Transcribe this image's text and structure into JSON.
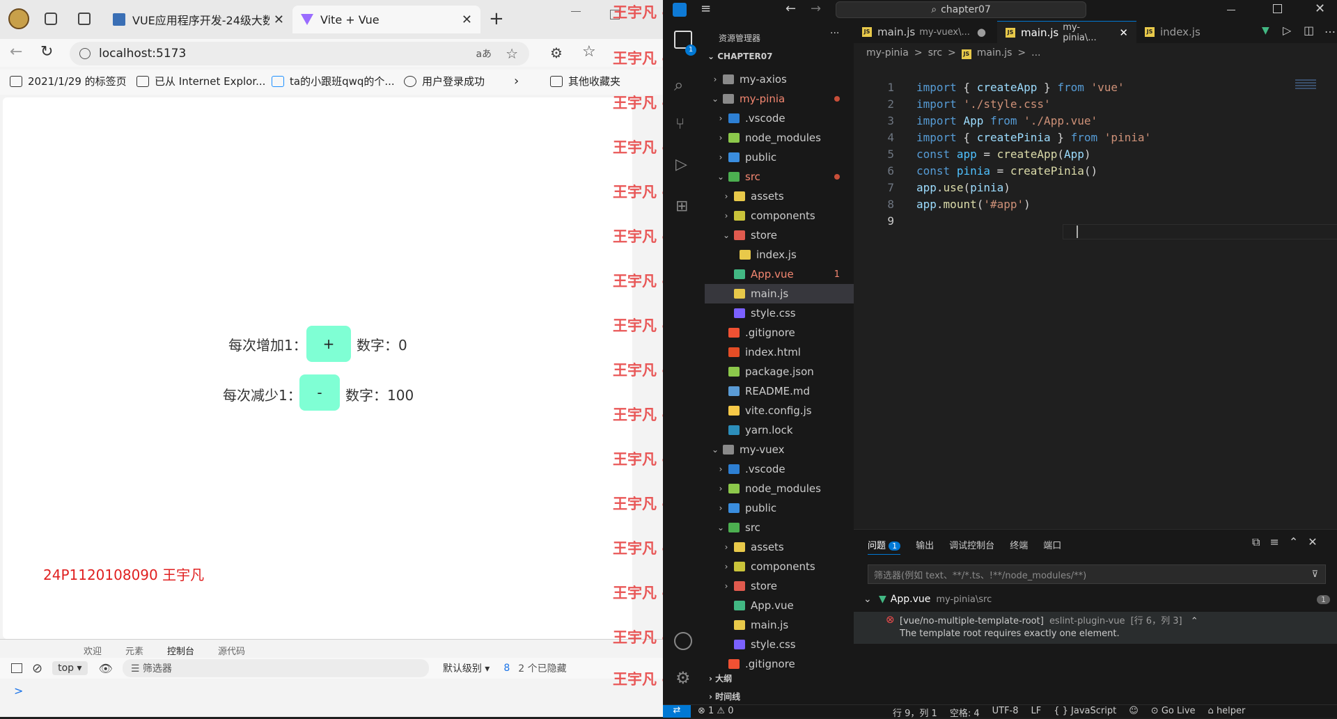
{
  "browser": {
    "tabs": [
      {
        "title": "VUE应用程序开发-24级大数据",
        "close": "✕"
      },
      {
        "title": "Vite + Vue",
        "close": "✕"
      }
    ],
    "new_tab": "+",
    "url": "localhost:5173",
    "read_aloud": "aあ",
    "favorites": [
      {
        "label": "2021/1/29 的标签页"
      },
      {
        "label": "已从 Internet Explor..."
      },
      {
        "label": "ta的小跟班qwq的个..."
      },
      {
        "label": "用户登录成功"
      }
    ],
    "favorites_more": "其他收藏夹",
    "page": {
      "row1": {
        "label": "每次增加1：",
        "button": "+",
        "value_label": "数字：0"
      },
      "row2": {
        "label": "每次减少1：",
        "button": "-",
        "value_label": "数字：100"
      },
      "student": "24P1120108090 王宇凡"
    },
    "devtools": {
      "tabs": [
        "欢迎",
        "元素",
        "控制台",
        "源代码"
      ],
      "context": "top",
      "filter_placeholder": "筛选器",
      "level": "默认级别",
      "issues_count": "8",
      "hidden": "2 个已隐藏",
      "prompt": ">"
    },
    "watermark": "王宇凡 -126 - 1452"
  },
  "vscode": {
    "search": "chapter07",
    "explorer_title": "资源管理器",
    "explorer_more": "···",
    "root": "CHAPTER07",
    "activity_badge": "1",
    "tree": [
      {
        "label": "my-axios",
        "indent": 1,
        "chev": "›",
        "kind": "folder"
      },
      {
        "label": "my-pinia",
        "indent": 1,
        "chev": "⌄",
        "kind": "folder",
        "dot": true
      },
      {
        "label": ".vscode",
        "indent": 2,
        "chev": "›",
        "kind": "vscode"
      },
      {
        "label": "node_modules",
        "indent": 2,
        "chev": "›",
        "kind": "node"
      },
      {
        "label": "public",
        "indent": 2,
        "chev": "›",
        "kind": "public"
      },
      {
        "label": "src",
        "indent": 2,
        "chev": "⌄",
        "kind": "src",
        "dot": true
      },
      {
        "label": "assets",
        "indent": 3,
        "chev": "›",
        "kind": "assets"
      },
      {
        "label": "components",
        "indent": 3,
        "chev": "›",
        "kind": "components"
      },
      {
        "label": "store",
        "indent": 3,
        "chev": "⌄",
        "kind": "store"
      },
      {
        "label": "index.js",
        "indent": 4,
        "chev": "",
        "kind": "js"
      },
      {
        "label": "App.vue",
        "indent": 3,
        "chev": "",
        "kind": "vue",
        "badge": "1"
      },
      {
        "label": "main.js",
        "indent": 3,
        "chev": "",
        "kind": "js",
        "selected": true
      },
      {
        "label": "style.css",
        "indent": 3,
        "chev": "",
        "kind": "css"
      },
      {
        "label": ".gitignore",
        "indent": 2,
        "chev": "",
        "kind": "git"
      },
      {
        "label": "index.html",
        "indent": 2,
        "chev": "",
        "kind": "html"
      },
      {
        "label": "package.json",
        "indent": 2,
        "chev": "",
        "kind": "json"
      },
      {
        "label": "README.md",
        "indent": 2,
        "chev": "",
        "kind": "md"
      },
      {
        "label": "vite.config.js",
        "indent": 2,
        "chev": "",
        "kind": "vite"
      },
      {
        "label": "yarn.lock",
        "indent": 2,
        "chev": "",
        "kind": "yarn"
      },
      {
        "label": "my-vuex",
        "indent": 1,
        "chev": "⌄",
        "kind": "folder"
      },
      {
        "label": ".vscode",
        "indent": 2,
        "chev": "›",
        "kind": "vscode"
      },
      {
        "label": "node_modules",
        "indent": 2,
        "chev": "›",
        "kind": "node"
      },
      {
        "label": "public",
        "indent": 2,
        "chev": "›",
        "kind": "public"
      },
      {
        "label": "src",
        "indent": 2,
        "chev": "⌄",
        "kind": "src"
      },
      {
        "label": "assets",
        "indent": 3,
        "chev": "›",
        "kind": "assets"
      },
      {
        "label": "components",
        "indent": 3,
        "chev": "›",
        "kind": "components"
      },
      {
        "label": "store",
        "indent": 3,
        "chev": "›",
        "kind": "store"
      },
      {
        "label": "App.vue",
        "indent": 3,
        "chev": "",
        "kind": "vue"
      },
      {
        "label": "main.js",
        "indent": 3,
        "chev": "",
        "kind": "js"
      },
      {
        "label": "style.css",
        "indent": 3,
        "chev": "",
        "kind": "css"
      },
      {
        "label": ".gitignore",
        "indent": 2,
        "chev": "",
        "kind": "git"
      }
    ],
    "outline": "大纲",
    "timeline": "时间线",
    "editor_tabs": [
      {
        "name": "main.js",
        "path": "my-vuex\\...",
        "state": "●"
      },
      {
        "name": "main.js",
        "path": "my-pinia\\...",
        "state": "✕"
      },
      {
        "name": "index.js",
        "path": "",
        "state": ""
      }
    ],
    "breadcrumb": [
      "my-pinia",
      ">",
      "src",
      ">",
      "main.js",
      ">",
      "..."
    ],
    "code_lines": [
      [
        [
          "kw",
          "import"
        ],
        [
          "pl",
          " { "
        ],
        [
          "vr",
          "createApp"
        ],
        [
          "pl",
          " } "
        ],
        [
          "kw",
          "from"
        ],
        [
          "pl",
          " "
        ],
        [
          "str",
          "'vue'"
        ]
      ],
      [
        [
          "kw",
          "import"
        ],
        [
          "pl",
          " "
        ],
        [
          "str",
          "'./style.css'"
        ]
      ],
      [
        [
          "kw",
          "import"
        ],
        [
          "pl",
          " "
        ],
        [
          "vr",
          "App"
        ],
        [
          "pl",
          " "
        ],
        [
          "kw",
          "from"
        ],
        [
          "pl",
          " "
        ],
        [
          "str",
          "'./App.vue'"
        ]
      ],
      [
        [
          "kw",
          "import"
        ],
        [
          "pl",
          " { "
        ],
        [
          "vr",
          "createPinia"
        ],
        [
          "pl",
          " } "
        ],
        [
          "kw",
          "from"
        ],
        [
          "pl",
          " "
        ],
        [
          "str",
          "'pinia'"
        ]
      ],
      [
        [
          "kw",
          "const"
        ],
        [
          "pl",
          " "
        ],
        [
          "cn",
          "app"
        ],
        [
          "pl",
          " = "
        ],
        [
          "fn",
          "createApp"
        ],
        [
          "pl",
          "("
        ],
        [
          "vr",
          "App"
        ],
        [
          "pl",
          ")"
        ]
      ],
      [
        [
          "kw",
          "const"
        ],
        [
          "pl",
          " "
        ],
        [
          "cn",
          "pinia"
        ],
        [
          "pl",
          " = "
        ],
        [
          "fn",
          "createPinia"
        ],
        [
          "pl",
          "()"
        ]
      ],
      [
        [
          "vr",
          "app"
        ],
        [
          "pl",
          "."
        ],
        [
          "fn",
          "use"
        ],
        [
          "pl",
          "("
        ],
        [
          "vr",
          "pinia"
        ],
        [
          "pl",
          ")"
        ]
      ],
      [
        [
          "vr",
          "app"
        ],
        [
          "pl",
          "."
        ],
        [
          "fn",
          "mount"
        ],
        [
          "pl",
          "("
        ],
        [
          "str",
          "'#app'"
        ],
        [
          "pl",
          ")"
        ]
      ],
      []
    ],
    "panel": {
      "tabs": [
        "问题",
        "输出",
        "调试控制台",
        "终端",
        "端口"
      ],
      "problems_badge": "1",
      "filter_placeholder": "筛选器(例如 text、**/*.ts、!**/node_modules/**)",
      "file": "App.vue",
      "file_path": "my-pinia\\src",
      "file_count": "1",
      "error_rule": "[vue/no-multiple-template-root]",
      "error_source": "eslint-plugin-vue",
      "error_loc": "[行 6，列 3]",
      "error_msg": "The template root requires exactly one element."
    },
    "status": {
      "remote": "⇄",
      "errors": "⊗ 1 ⚠ 0",
      "position": "行 9，列 1",
      "spaces": "空格: 4",
      "encoding": "UTF-8",
      "eol": "LF",
      "language": "{ } JavaScript",
      "golive": "Go Live",
      "helper": "helper"
    }
  }
}
